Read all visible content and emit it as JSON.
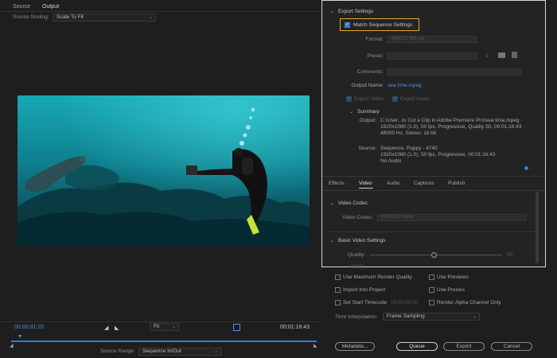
{
  "source_panel": {
    "tabs": [
      {
        "label": "Source"
      },
      {
        "label": "Output"
      }
    ],
    "source_scaling_label": "Source Scaling:",
    "source_scaling_value": "Scale To Fit"
  },
  "playback": {
    "timecode_start": "00:00:01:20",
    "timecode_end": "00:01:16:43",
    "zoom_value": "Fit",
    "source_range_label": "Source Range:",
    "source_range_value": "Sequence In/Out",
    "playhead_fraction": 0.02
  },
  "export_settings": {
    "title": "Export Settings",
    "match_sequence_label": "Match Sequence Settings",
    "match_sequence_checked": true,
    "format_label": "Format:",
    "format_value": "MPEG2 Blu-ray",
    "preset_label": "Preset:",
    "preset_value": "",
    "comments_label": "Comments:",
    "output_name_label": "Output Name:",
    "output_name_value": "sea time.mpeg",
    "export_video_label": "Export Video",
    "export_audio_label": "Export Audio",
    "summary": {
      "title": "Summary",
      "output_label": "Output:",
      "output_lines": [
        "C:\\User...to Cut a Clip in Adobe Premiere Pro\\sea time.mpeg",
        "1920x1080 (1.0), 50 fps, Progressive, Quality 50, 00:01:16:43",
        "48000 Hz, Stereo, 16 bit"
      ],
      "source_label": "Source:",
      "source_lines": [
        "Sequence, Puppy - 4740",
        "1920x1080 (1.0), 50 fps, Progressive, 00:01:16:43",
        "No Audio"
      ]
    }
  },
  "settings_tabs": [
    {
      "label": "Effects"
    },
    {
      "label": "Video"
    },
    {
      "label": "Audio"
    },
    {
      "label": "Captions"
    },
    {
      "label": "Publish"
    }
  ],
  "video_codec": {
    "title": "Video Codec",
    "codec_label": "Video Codec:",
    "codec_value": "MPEG2 Frame"
  },
  "basic_video": {
    "title": "Basic Video Settings",
    "quality_label": "Quality:",
    "quality_value": "50",
    "quality_fraction": 0.48,
    "width_label": "Width:"
  },
  "options": {
    "max_render_quality": "Use Maximum Render Quality",
    "use_previews": "Use Previews",
    "import_into_project": "Import Into Project",
    "use_proxies": "Use Proxies",
    "set_start_timecode": "Set Start Timecode",
    "start_timecode_value": "00:00:00:00",
    "render_alpha": "Render Alpha Channel Only",
    "time_interpolation_label": "Time Interpolation:",
    "time_interpolation_value": "Frame Sampling"
  },
  "buttons": {
    "metadata": "Metadata...",
    "queue": "Queue",
    "export": "Export",
    "cancel": "Cancel"
  }
}
